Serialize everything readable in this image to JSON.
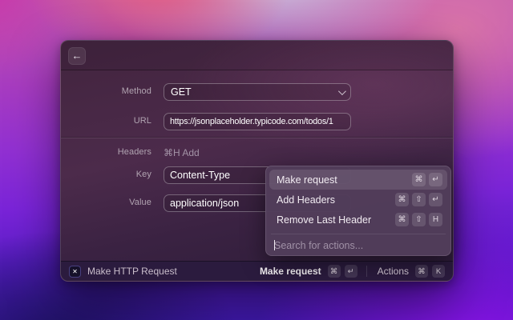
{
  "header": {
    "back_icon": "←"
  },
  "form": {
    "method_label": "Method",
    "method_value": "GET",
    "url_label": "URL",
    "url_value": "https://jsonplaceholder.typicode.com/todos/1",
    "headers_label": "Headers",
    "headers_add_hint": "⌘H Add",
    "key_label": "Key",
    "key_value": "Content-Type",
    "value_label": "Value",
    "value_value": "application/json"
  },
  "actions_panel": {
    "items": [
      {
        "label": "Make request",
        "keys": [
          "⌘",
          "↵"
        ],
        "selected": true
      },
      {
        "label": "Add Headers",
        "keys": [
          "⌘",
          "⇧",
          "↵"
        ],
        "selected": false
      },
      {
        "label": "Remove Last Header",
        "keys": [
          "⌘",
          "⇧",
          "H"
        ],
        "selected": false
      }
    ],
    "search_placeholder": "Search for actions..."
  },
  "footer": {
    "extension_glyph": "✕",
    "app_title": "Make HTTP Request",
    "primary_action": "Make request",
    "primary_keys": [
      "⌘",
      "↵"
    ],
    "actions_label": "Actions",
    "actions_keys": [
      "⌘",
      "K"
    ]
  },
  "colors": {
    "panel_bg": "#523d5a",
    "selected_row": "rgba(255,255,255,0.11)",
    "window_bg": "#452742",
    "footer_bg": "#2b1b3e",
    "accent_text": "#f2ecf2"
  }
}
